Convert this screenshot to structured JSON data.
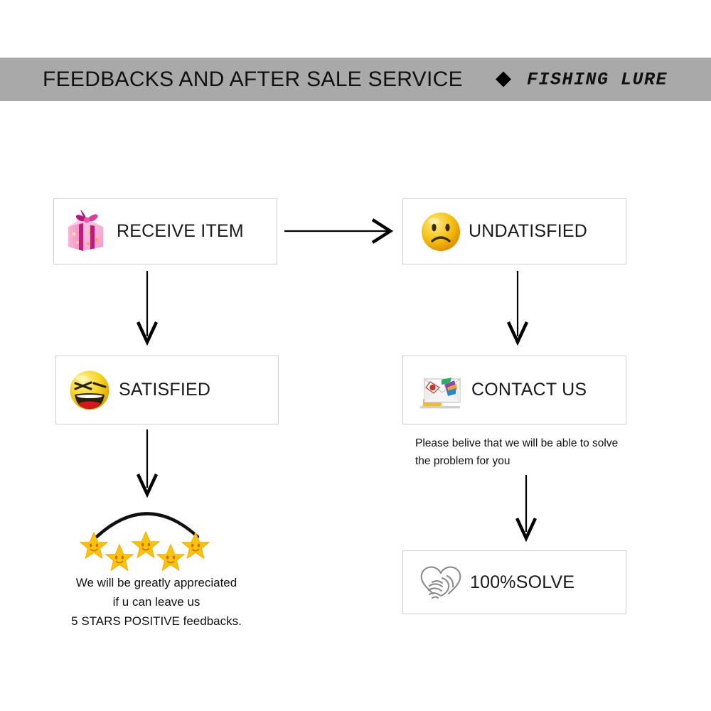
{
  "header": {
    "title": "FEEDBACKS AND AFTER SALE SERVICE",
    "brand_marker": "diamond-icon",
    "brand": "FISHING LURE",
    "background_color": "#a9a9a9"
  },
  "flow": {
    "boxes": [
      {
        "id": "receive",
        "label": "RECEIVE ITEM",
        "icon": "gift-box-icon",
        "icon_colors": {
          "primary": "#f58ec2",
          "ribbon": "#b5167f",
          "accent": "#f9a84a"
        }
      },
      {
        "id": "undatisfied",
        "label": "UNDATISFIED",
        "icon": "sad-face-icon",
        "icon_colors": {
          "primary": "#f5c518",
          "shade": "#e8a400"
        }
      },
      {
        "id": "satisfied",
        "label": "SATISFIED",
        "icon": "laughing-face-icon",
        "icon_colors": {
          "primary": "#f5d423",
          "mouth": "#d81521"
        }
      },
      {
        "id": "contact",
        "label": "CONTACT US",
        "icon": "envelope-icon",
        "icon_colors": {
          "primary": "#efefef",
          "accent": "#c0392b"
        }
      },
      {
        "id": "solve",
        "label": "100%SOLVE",
        "icon": "handshake-heart-icon",
        "icon_colors": {
          "primary": "#8a8a8a"
        }
      }
    ],
    "arrows": [
      {
        "name": "receive-to-undatisfied",
        "direction": "right"
      },
      {
        "name": "receive-to-satisfied",
        "direction": "down"
      },
      {
        "name": "undatisfied-to-contact",
        "direction": "down"
      },
      {
        "name": "satisfied-to-stars",
        "direction": "down"
      },
      {
        "name": "contact-to-solve",
        "direction": "down"
      }
    ]
  },
  "contact_note": "Please belive that we will be able to solve\nthe problem for you",
  "rating": {
    "star_count": 5,
    "star_color": "#fbc40b",
    "note": "We will be greatly appreciated\nif u can leave us\n5 STARS POSITIVE feedbacks."
  }
}
